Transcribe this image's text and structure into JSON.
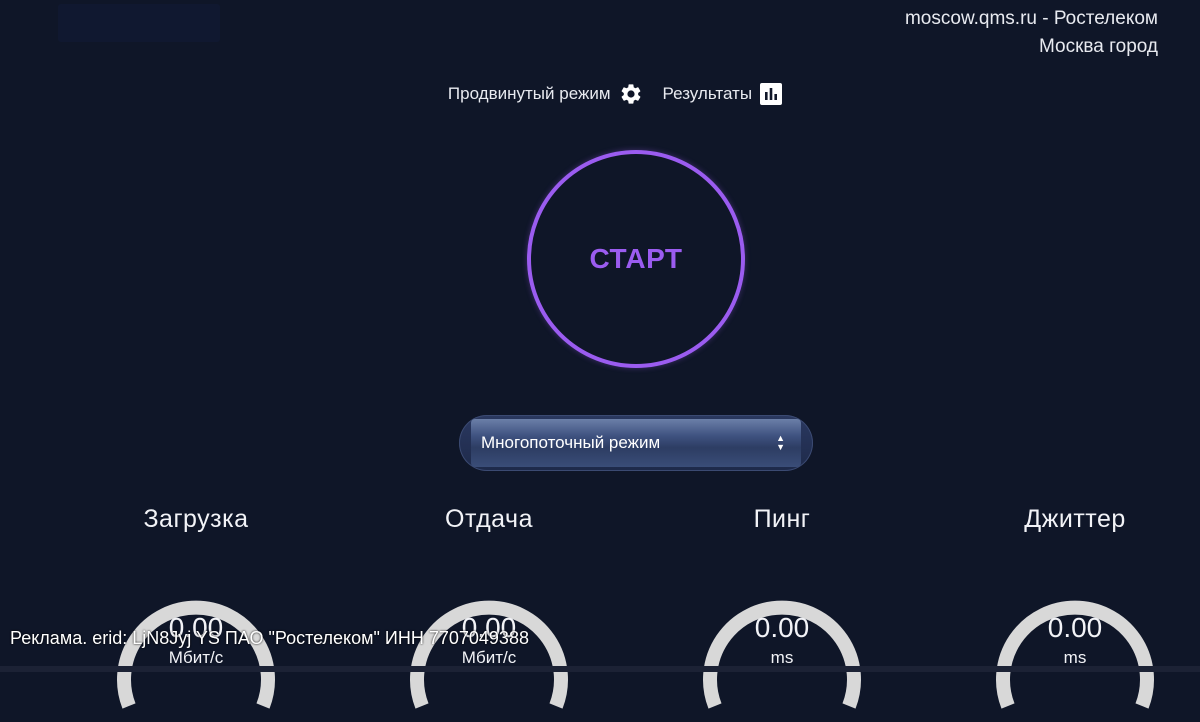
{
  "server": {
    "host": "moscow.qms.ru - Ростелеком",
    "city": "Москва город"
  },
  "nav": {
    "advanced_label": "Продвинутый режим",
    "advanced_icon": "gear-icon",
    "results_label": "Результаты",
    "results_icon": "bar-chart-icon"
  },
  "start": {
    "label": "СТАРТ",
    "color": "#9b5cf0"
  },
  "mode": {
    "selected": "Многопоточный режим"
  },
  "metrics": {
    "download": {
      "title": "Загрузка",
      "value": "0.00",
      "unit": "Мбит/с"
    },
    "upload": {
      "title": "Отдача",
      "value": "0.00",
      "unit": "Мбит/с"
    },
    "ping": {
      "title": "Пинг",
      "value": "0.00",
      "unit": "ms"
    },
    "jitter": {
      "title": "Джиттер",
      "value": "0.00",
      "unit": "ms"
    }
  },
  "ad": {
    "text": "Реклама. erid: LjN8Jyj YS ПАО \"Ростелеком\" ИНН 7707049388"
  },
  "colors": {
    "background": "#0f1628",
    "accent": "#9b5cf0",
    "gauge_track": "#d8d8d8"
  }
}
